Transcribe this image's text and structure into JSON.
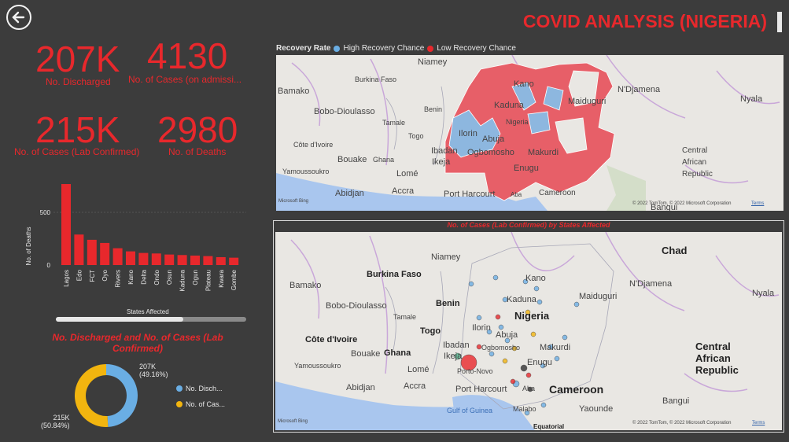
{
  "header": {
    "title": "COVID ANALYSIS (NIGERIA)"
  },
  "kpis": {
    "discharged": {
      "value": "207K",
      "label": "No. Discharged"
    },
    "admission": {
      "value": "4130",
      "label": "No. of Cases (on admissi..."
    },
    "lab_confirmed": {
      "value": "215K",
      "label": "No. of Cases (Lab Confirmed)"
    },
    "deaths": {
      "value": "2980",
      "label": "No. of Deaths"
    }
  },
  "bar_chart": {
    "ylabel": "No. of Deaths",
    "xlabel": "States Affected",
    "yticks": [
      "500",
      "0"
    ]
  },
  "donut": {
    "title": "No. Discharged and No. of Cases (Lab Confirmed)",
    "slice1_value": "207K",
    "slice1_pct": "(49.16%)",
    "slice2_value": "215K",
    "slice2_pct": "(50.84%)",
    "legend": [
      "No. Disch...",
      "No. of Cas..."
    ]
  },
  "map1": {
    "legend_title": "Recovery Rate",
    "legend_items": [
      "High Recovery Chance",
      "Low Recovery Chance"
    ],
    "labels": [
      "Niamey",
      "Burkina Faso",
      "Bamako",
      "Bobo-Dioulasso",
      "Benin",
      "Tamale",
      "Togo",
      "Côte d'Ivoire",
      "Bouake",
      "Ghana",
      "Yamoussoukro",
      "Abidjan",
      "Accra",
      "Lomé",
      "Port Harcourt",
      "Aba",
      "Cameroon",
      "Kano",
      "Kaduna",
      "Nigeria",
      "Ilorin",
      "Abuja",
      "Ibadan",
      "Ikeja",
      "Ogbomosho",
      "Makurdi",
      "Enugu",
      "Maiduguri",
      "N'Djamena",
      "Nyala",
      "Central",
      "African",
      "Republic",
      "Bangui"
    ],
    "attribution": "© 2022 TomTom, © 2022 Microsoft Corporation",
    "terms": "Terms",
    "provider": "Microsoft Bing"
  },
  "map2": {
    "title": "No. of Cases (Lab Confirmed) by States Affected",
    "labels": [
      "Niamey",
      "Burkina Faso",
      "Bamako",
      "Bobo-Dioulasso",
      "Benin",
      "Tamale",
      "Togo",
      "Côte d'Ivoire",
      "Bouake",
      "Ghana",
      "Yamoussoukro",
      "Abidjan",
      "Accra",
      "Lomé",
      "Gulf of Guinea",
      "Port Harcourt",
      "Aba",
      "Cameroon",
      "Yaounde",
      "Malabo",
      "Equatorial",
      "Kano",
      "Kaduna",
      "Nigeria",
      "Ilorin",
      "Abuja",
      "Ibadan",
      "Ikeja",
      "Ogbomosho",
      "Porto-Novo",
      "Makurdi",
      "Enugu",
      "Maiduguri",
      "N'Djamena",
      "Chad",
      "Nyala",
      "Central",
      "African",
      "Republic",
      "Bangui"
    ],
    "attribution": "© 2022 TomTom, © 2022 Microsoft Corporation",
    "terms": "Terms",
    "provider": "Microsoft Bing"
  },
  "colors": {
    "accent": "#e8282c",
    "blue": "#6aaee4",
    "yellow": "#f2b50f",
    "bg": "#3c3c3c"
  },
  "chart_data": [
    {
      "type": "bar",
      "categories": [
        "Lagos",
        "Edo",
        "FCT",
        "Oyo",
        "Rivers",
        "Kano",
        "Delta",
        "Ondo",
        "Osun",
        "Kaduna",
        "Ogun",
        "Plateau",
        "Kwara",
        "Gombe"
      ],
      "values": [
        770,
        290,
        240,
        210,
        160,
        130,
        115,
        110,
        100,
        95,
        90,
        85,
        75,
        70
      ],
      "xlabel": "States Affected",
      "ylabel": "No. of Deaths",
      "ylim": [
        0,
        800
      ]
    },
    {
      "type": "pie",
      "categories": [
        "No. Discharged",
        "No. of Cases (Lab Confirmed)"
      ],
      "values": [
        207,
        215
      ],
      "percent": [
        49.16,
        50.84
      ],
      "title": "No. Discharged and No. of Cases (Lab Confirmed)"
    }
  ]
}
